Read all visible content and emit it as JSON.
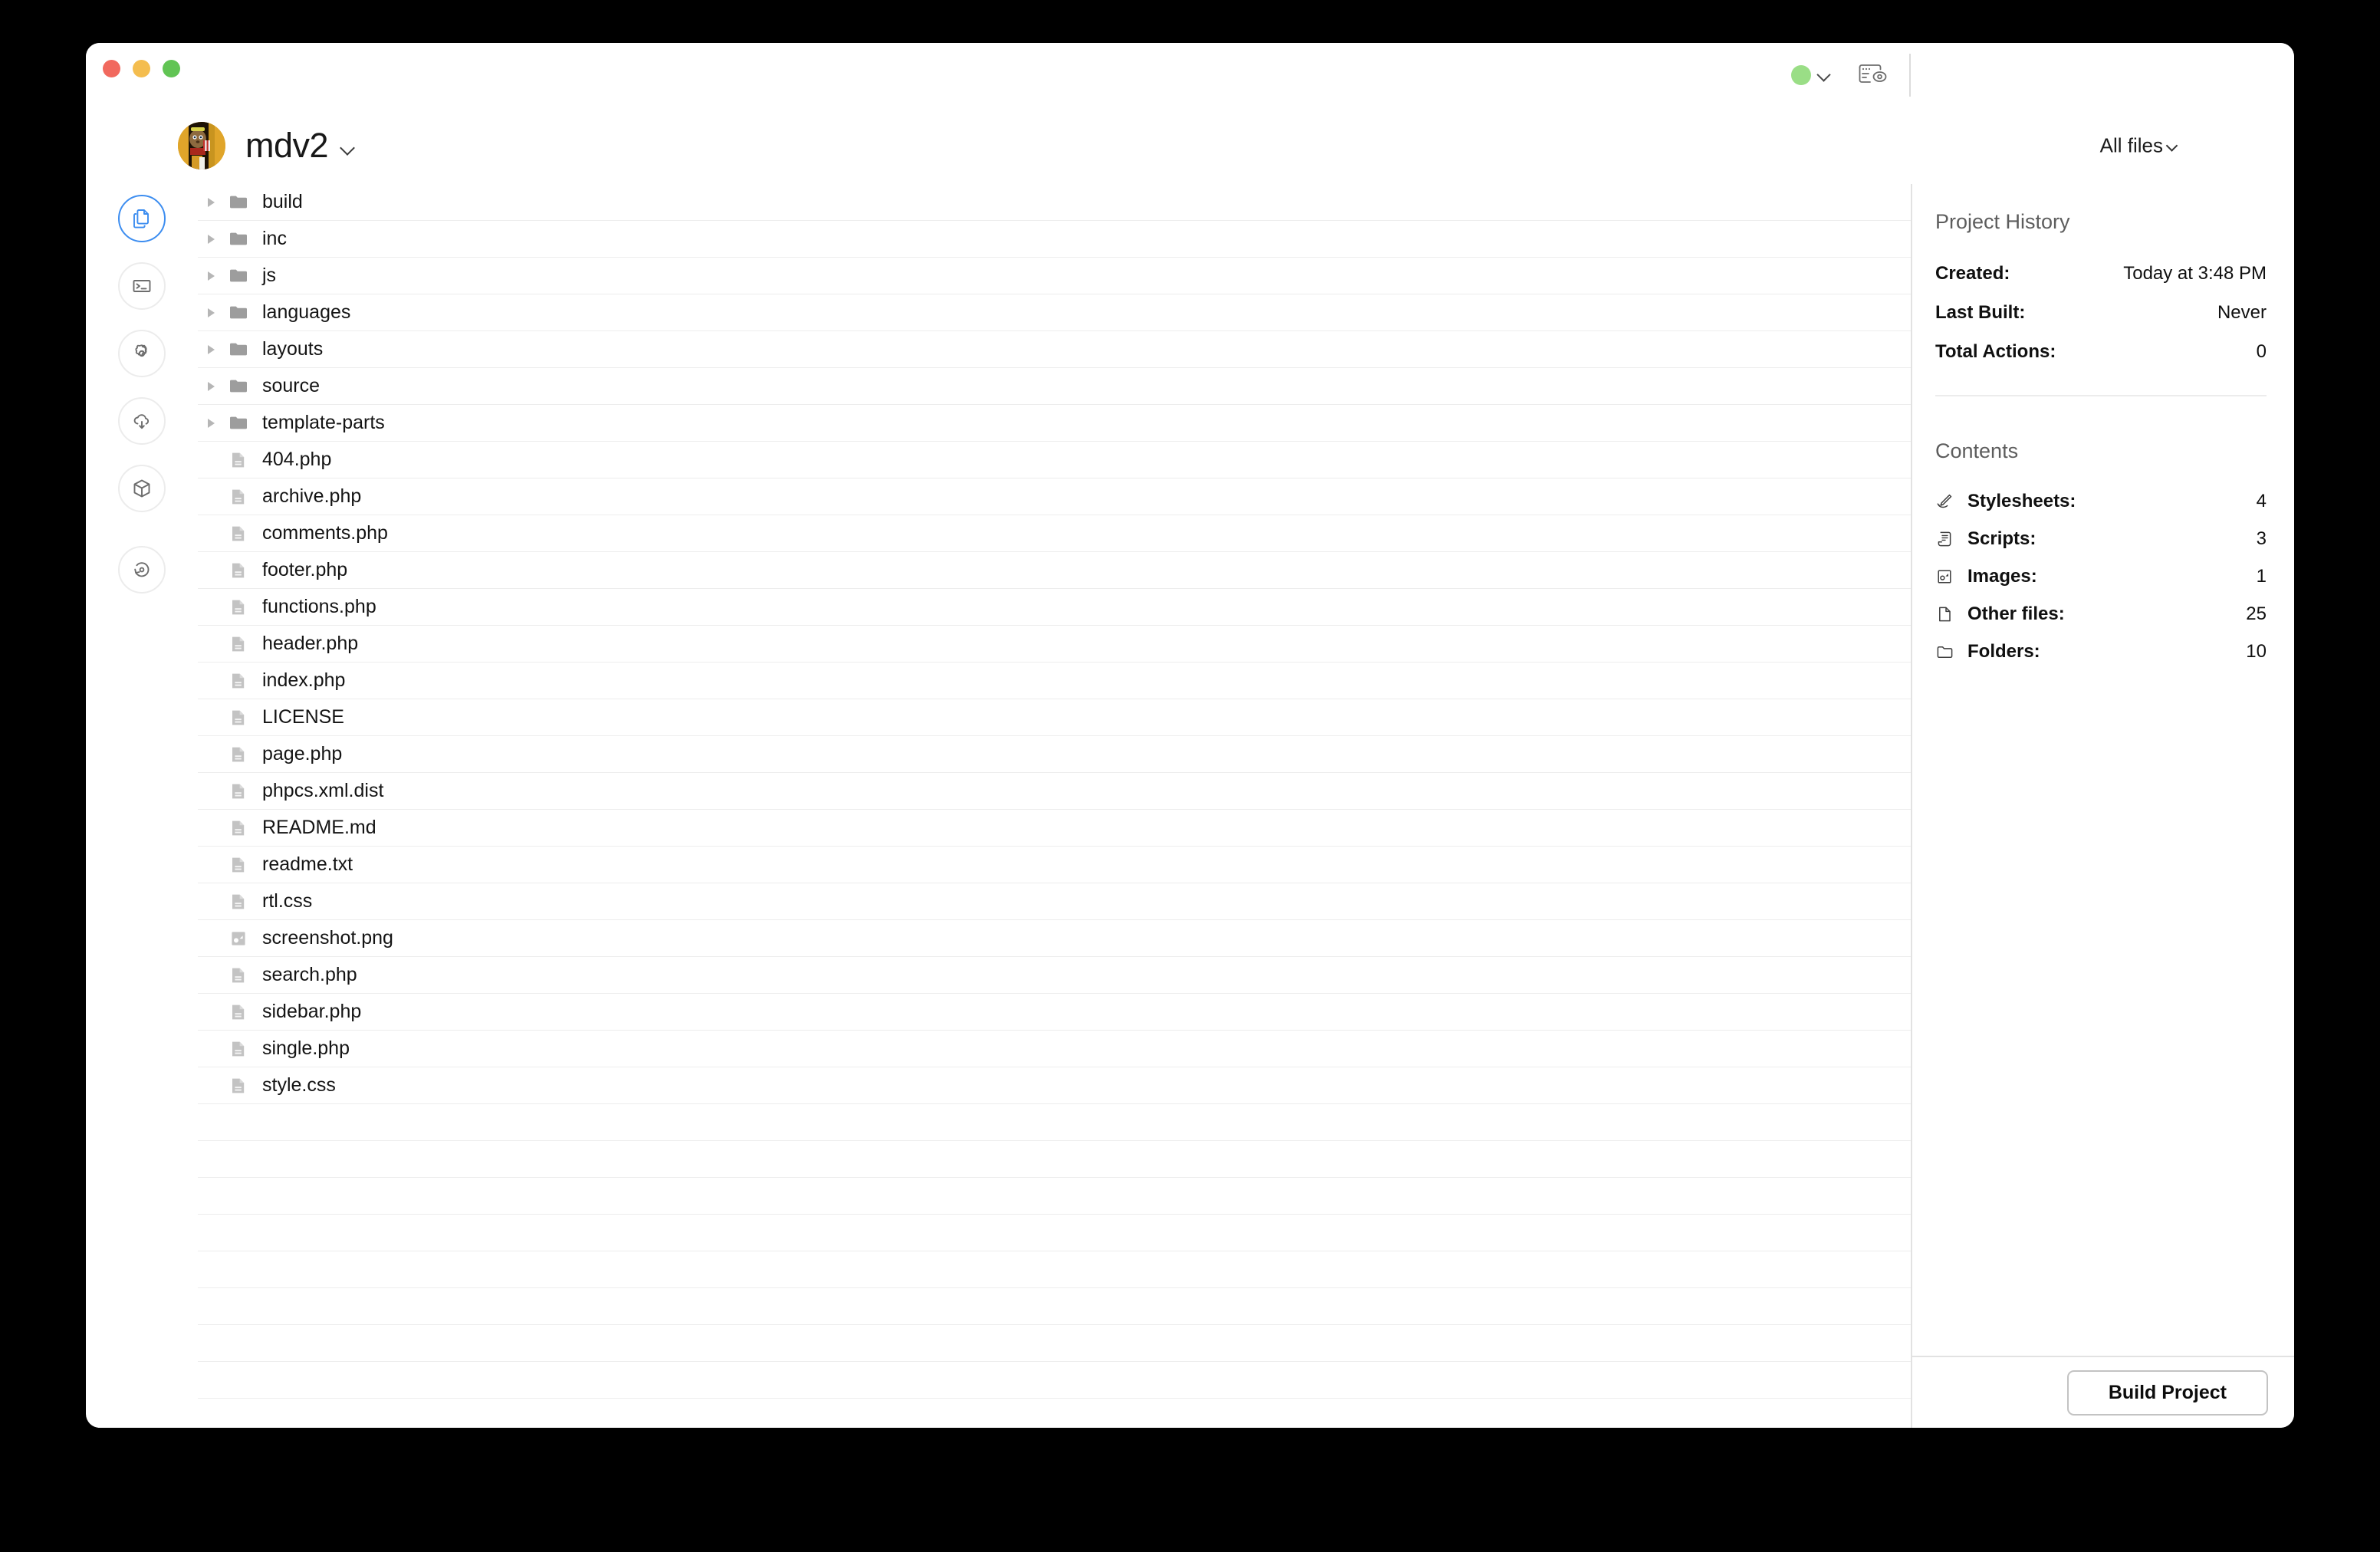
{
  "window": {
    "traffic_lights": [
      "close",
      "minimize",
      "zoom"
    ],
    "colors": {
      "close": "#f1695e",
      "minimize": "#f4bd4f",
      "zoom": "#61c454",
      "status_green": "#9ade86",
      "accent_blue": "#3c8df0"
    }
  },
  "titlebar": {
    "status_indicator": "server-running",
    "preview_label": "preview"
  },
  "header": {
    "project_name": "mdv2",
    "avatar_alt": "project-avatar",
    "filter_label": "All files"
  },
  "rail": {
    "items": [
      {
        "name": "files",
        "icon": "files-icon",
        "active": true
      },
      {
        "name": "terminal",
        "icon": "terminal-icon",
        "active": false
      },
      {
        "name": "settings",
        "icon": "gear-icon",
        "active": false
      },
      {
        "name": "deploy",
        "icon": "cloud-download-icon",
        "active": false
      },
      {
        "name": "packages",
        "icon": "cube-icon",
        "active": false
      },
      {
        "name": "history",
        "icon": "restore-icon",
        "active": false
      }
    ]
  },
  "filelist": {
    "entries": [
      {
        "name": "build",
        "type": "folder",
        "icon": "folder-icon",
        "expandable": true
      },
      {
        "name": "inc",
        "type": "folder",
        "icon": "folder-icon",
        "expandable": true
      },
      {
        "name": "js",
        "type": "folder",
        "icon": "folder-icon",
        "expandable": true
      },
      {
        "name": "languages",
        "type": "folder",
        "icon": "folder-icon",
        "expandable": true
      },
      {
        "name": "layouts",
        "type": "folder",
        "icon": "folder-icon",
        "expandable": true
      },
      {
        "name": "source",
        "type": "folder",
        "icon": "folder-icon",
        "expandable": true
      },
      {
        "name": "template-parts",
        "type": "folder",
        "icon": "folder-icon",
        "expandable": true
      },
      {
        "name": "404.php",
        "type": "file",
        "icon": "document-icon",
        "expandable": false
      },
      {
        "name": "archive.php",
        "type": "file",
        "icon": "document-icon",
        "expandable": false
      },
      {
        "name": "comments.php",
        "type": "file",
        "icon": "document-icon",
        "expandable": false
      },
      {
        "name": "footer.php",
        "type": "file",
        "icon": "document-icon",
        "expandable": false
      },
      {
        "name": "functions.php",
        "type": "file",
        "icon": "document-icon",
        "expandable": false
      },
      {
        "name": "header.php",
        "type": "file",
        "icon": "document-icon",
        "expandable": false
      },
      {
        "name": "index.php",
        "type": "file",
        "icon": "document-icon",
        "expandable": false
      },
      {
        "name": "LICENSE",
        "type": "file",
        "icon": "document-icon",
        "expandable": false
      },
      {
        "name": "page.php",
        "type": "file",
        "icon": "document-icon",
        "expandable": false
      },
      {
        "name": "phpcs.xml.dist",
        "type": "file",
        "icon": "document-icon",
        "expandable": false
      },
      {
        "name": "README.md",
        "type": "file",
        "icon": "document-icon",
        "expandable": false
      },
      {
        "name": "readme.txt",
        "type": "file",
        "icon": "document-icon",
        "expandable": false
      },
      {
        "name": "rtl.css",
        "type": "file",
        "icon": "document-icon",
        "expandable": false
      },
      {
        "name": "screenshot.png",
        "type": "image",
        "icon": "image-icon",
        "expandable": false
      },
      {
        "name": "search.php",
        "type": "file",
        "icon": "document-icon",
        "expandable": false
      },
      {
        "name": "sidebar.php",
        "type": "file",
        "icon": "document-icon",
        "expandable": false
      },
      {
        "name": "single.php",
        "type": "file",
        "icon": "document-icon",
        "expandable": false
      },
      {
        "name": "style.css",
        "type": "file",
        "icon": "document-icon",
        "expandable": false
      }
    ],
    "empty_row_count": 8
  },
  "panel": {
    "history_heading": "Project History",
    "history_rows": [
      {
        "label": "Created:",
        "value": "Today at 3:48 PM"
      },
      {
        "label": "Last Built:",
        "value": "Never"
      },
      {
        "label": "Total Actions:",
        "value": "0"
      }
    ],
    "contents_heading": "Contents",
    "contents_rows": [
      {
        "icon": "stylesheet-icon",
        "label": "Stylesheets:",
        "value": "4"
      },
      {
        "icon": "script-icon",
        "label": "Scripts:",
        "value": "3"
      },
      {
        "icon": "image-icon",
        "label": "Images:",
        "value": "1"
      },
      {
        "icon": "document-icon",
        "label": "Other files:",
        "value": "25"
      },
      {
        "icon": "folder-outline-icon",
        "label": "Folders:",
        "value": "10"
      }
    ],
    "build_button_label": "Build Project"
  }
}
